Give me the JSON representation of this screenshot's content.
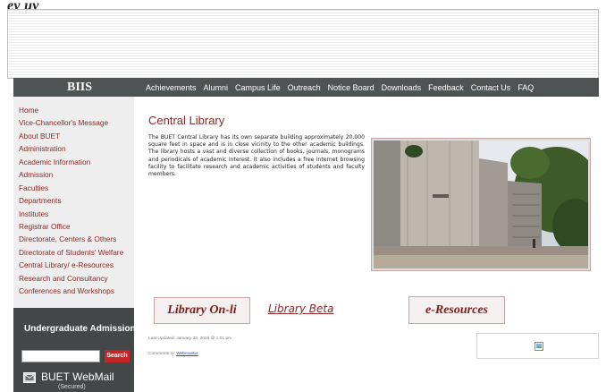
{
  "header": {
    "top_fragment": "ey uy",
    "logo": "BIIS",
    "nav": [
      "Achievements",
      "Alumni",
      "Campus Life",
      "Outreach",
      "Notice Board",
      "Downloads",
      "Feedback",
      "Contact Us",
      "FAQ"
    ]
  },
  "sidebar": {
    "menu": [
      "Home",
      "Vice-Chancellor's Message",
      "About BUET",
      "Administration",
      "Academic Information",
      "Admission",
      "Faculties",
      "Departments",
      "Institutes",
      "Registrar Office",
      "Directorate, Centers & Others",
      "Directorate of Students' Welfare",
      "Central Library/ e-Resources",
      "Research and Consultancy",
      "Conferences and Workshops"
    ],
    "ug_title": "Undergraduate Admission",
    "search_value": "",
    "search_button": "Search",
    "webmail_title": "BUET WebMail",
    "webmail_sub": "(Secured)"
  },
  "main": {
    "title": "Central Library",
    "intro": "The BUET Central Library has its own separate building approximately 20,000 square feet in space and is in close vicinity to the other academic buildings. The library hosts a vast and diverse collection of books, journals, monograms and periodicals of academic interest. It also includes a free internet browsing facility to facilitate research and academic activities of students and faculty members.",
    "library_online": "Library On-li",
    "library_beta": "Library Beta",
    "eresources": "e-Resources",
    "last_updated": "Last Updated: January 28, 2015 @ 1:01 pm",
    "comments_prefix": "Comments to: ",
    "webmaster": "Webmaster"
  },
  "colors": {
    "navbar": "#4e5353",
    "sidebar_bg": "#eeeeee",
    "menu_link": "#8c2727",
    "admission_box": "#434747",
    "search_button": "#c62626"
  },
  "icons": {
    "webmail": "webmail-envelope-icon",
    "broken_image": "broken-image-icon"
  }
}
